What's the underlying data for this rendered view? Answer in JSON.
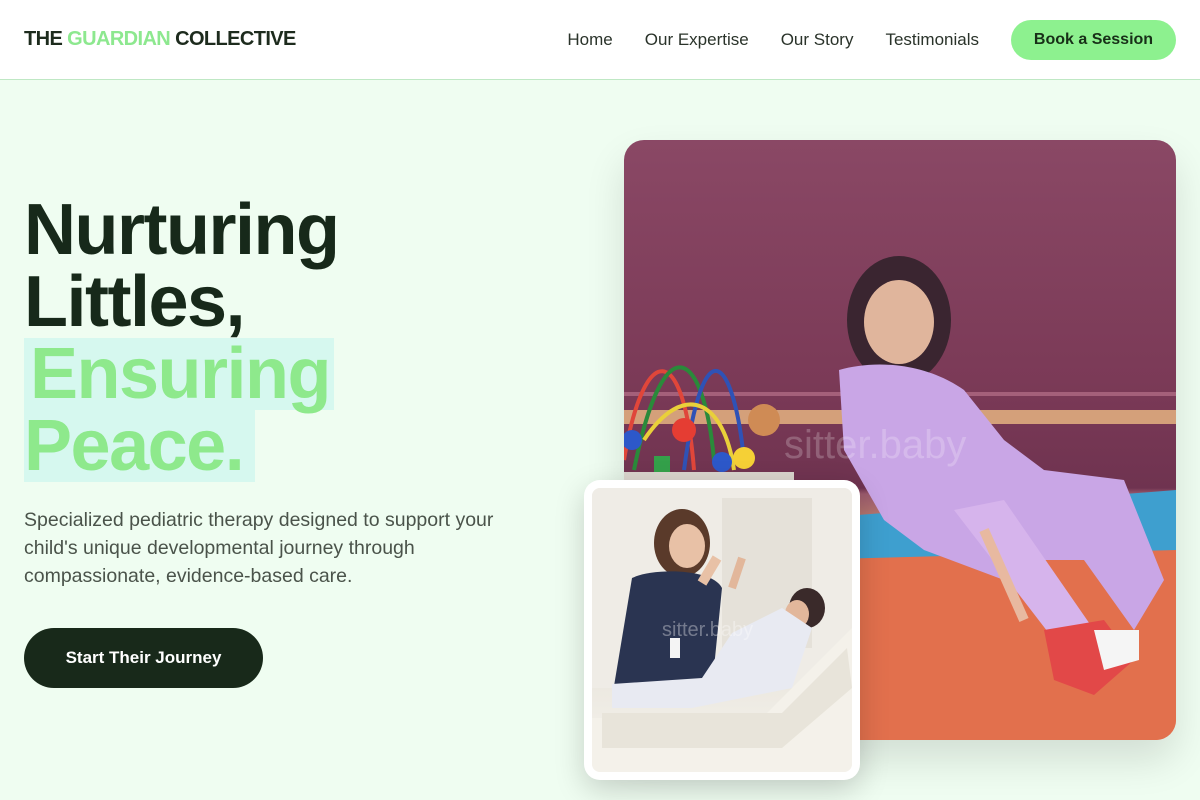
{
  "header": {
    "logo": {
      "part1": "THE ",
      "part2": "GUARDIAN",
      "part3": " COLLECTIVE"
    },
    "nav": [
      {
        "label": "Home"
      },
      {
        "label": "Our Expertise"
      },
      {
        "label": "Our Story"
      },
      {
        "label": "Testimonials"
      }
    ],
    "cta": "Book a Session"
  },
  "hero": {
    "title_line1": "Nurturing",
    "title_line2": "Littles,",
    "title_line3": "Ensuring",
    "title_line4": "Peace.",
    "subtitle": "Specialized pediatric therapy designed to support your child's unique developmental journey through compassionate, evidence-based care.",
    "cta": "Start Their Journey"
  },
  "images": {
    "main": "child-in-purple-outfit-photo",
    "secondary": "therapist-high-five-photo",
    "watermark": "sitter.baby"
  },
  "colors": {
    "background": "#effdf1",
    "accent": "#8df18f",
    "dark": "#18291a"
  }
}
